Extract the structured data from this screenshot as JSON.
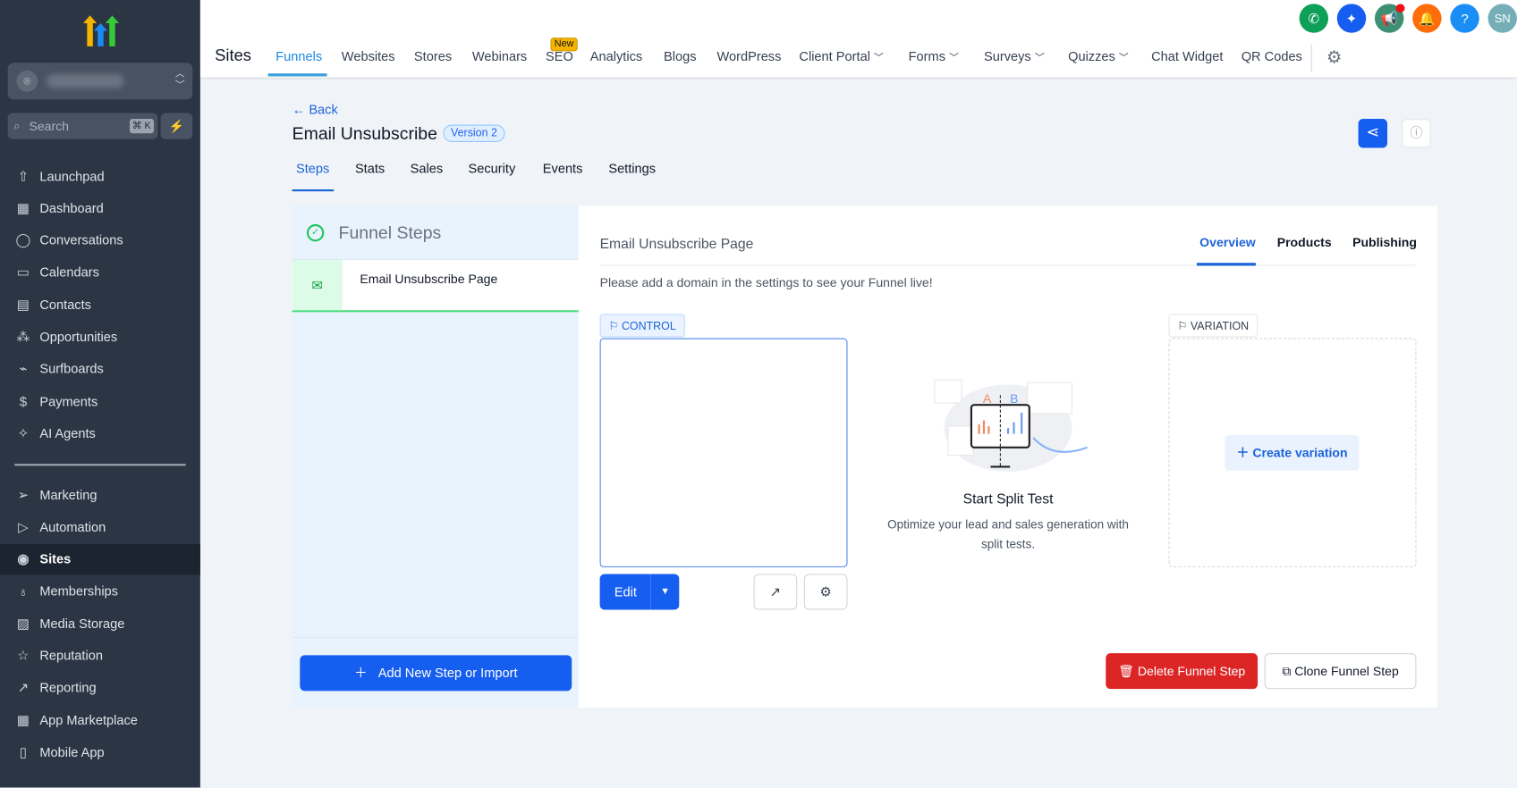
{
  "sidebar": {
    "account_avatar_icon": "location-pin",
    "search_placeholder": "Search",
    "search_shortcut": "⌘ K",
    "items_top": [
      "Launchpad",
      "Dashboard",
      "Conversations",
      "Calendars",
      "Contacts",
      "Opportunities",
      "Surfboards",
      "Payments",
      "AI Agents"
    ],
    "items_bottom": [
      "Marketing",
      "Automation",
      "Sites",
      "Memberships",
      "Media Storage",
      "Reputation",
      "Reporting",
      "App Marketplace",
      "Mobile App"
    ],
    "active": "Sites"
  },
  "topbar": {
    "section": "Sites",
    "tabs": [
      "Funnels",
      "Websites",
      "Stores",
      "Webinars",
      "SEO",
      "Analytics",
      "Blogs",
      "WordPress",
      "Client Portal",
      "Forms",
      "Surveys",
      "Quizzes",
      "Chat Widget",
      "QR Codes"
    ],
    "active_tab": "Funnels",
    "new_badge": "New",
    "avatar_initials": "SN",
    "colors": {
      "phone": "#0e9f58",
      "ai": "#155eef",
      "announce": "#3f8f74",
      "bell": "#ff6d0a",
      "help": "#1b8ef5",
      "avatar": "#76aeb8"
    }
  },
  "page": {
    "back": "Back",
    "title": "Email Unsubscribe",
    "version": "Version 2",
    "tabs": [
      "Steps",
      "Stats",
      "Sales",
      "Security",
      "Events",
      "Settings"
    ],
    "active_tab": "Steps"
  },
  "steps_panel": {
    "heading": "Funnel Steps",
    "steps": [
      "Email Unsubscribe Page"
    ],
    "add_button": "Add New Step or Import"
  },
  "detail": {
    "page_title": "Email Unsubscribe Page",
    "tabs": [
      "Overview",
      "Products",
      "Publishing"
    ],
    "active_tab": "Overview",
    "notice": "Please add a domain in the settings to see your Funnel live!",
    "control_label": "CONTROL",
    "variation_label": "VARIATION",
    "create_variation": "Create variation",
    "edit": "Edit",
    "split_title": "Start Split Test",
    "split_desc": "Optimize your lead and sales generation with split tests.",
    "illustration_a": "A",
    "illustration_b": "B",
    "delete": "Delete Funnel Step",
    "clone": "Clone Funnel Step"
  }
}
